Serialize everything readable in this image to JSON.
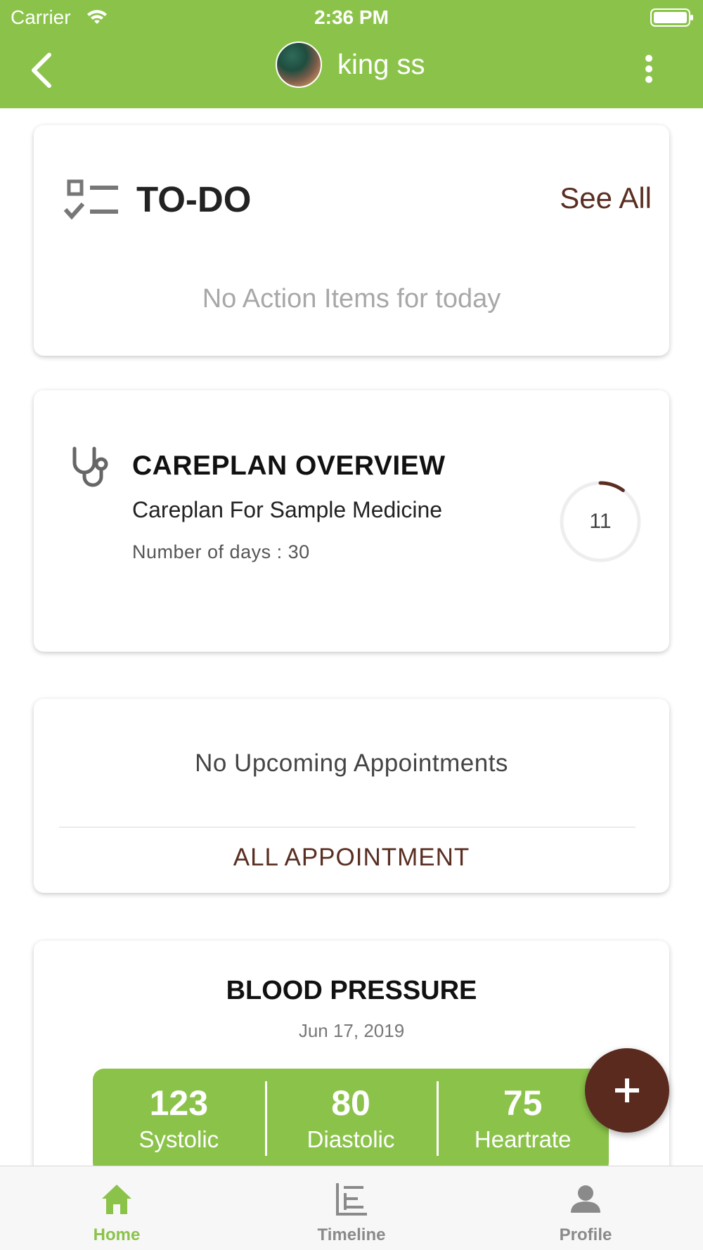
{
  "status_bar": {
    "carrier": "Carrier",
    "time": "2:36 PM"
  },
  "header": {
    "title": "king ss"
  },
  "todo": {
    "title": "TO-DO",
    "see_all": "See All",
    "empty_message": "No Action Items for today"
  },
  "careplan": {
    "title": "CAREPLAN OVERVIEW",
    "name": "Careplan For Sample Medicine",
    "days_text": "Number of days : 30",
    "progress_value": "11",
    "progress_fraction": 0.1
  },
  "appointments": {
    "empty_message": "No Upcoming Appointments",
    "link_label": "ALL APPOINTMENT"
  },
  "blood_pressure": {
    "title": "BLOOD PRESSURE",
    "date": "Jun 17, 2019",
    "metrics": [
      {
        "value": "123",
        "label": "Systolic"
      },
      {
        "value": "80",
        "label": "Diastolic"
      },
      {
        "value": "75",
        "label": "Heartrate"
      }
    ]
  },
  "fab": {
    "icon": "plus-icon"
  },
  "tabbar": {
    "items": [
      {
        "label": "Home",
        "icon": "home-icon",
        "active": true
      },
      {
        "label": "Timeline",
        "icon": "timeline-icon",
        "active": false
      },
      {
        "label": "Profile",
        "icon": "profile-icon",
        "active": false
      }
    ]
  },
  "colors": {
    "brand_green": "#8bc34a",
    "accent_brown": "#5a2e22"
  }
}
